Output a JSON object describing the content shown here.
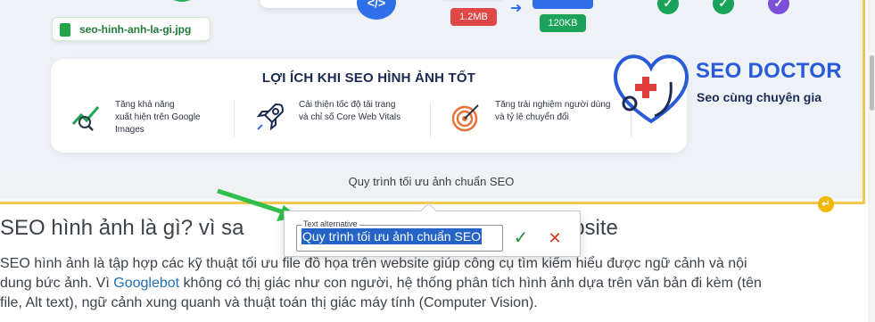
{
  "figure": {
    "file_name": "seo-hinh-anh-la-gi.jpg",
    "code_icon": "</>",
    "size_before": "1.2MB",
    "size_after": "120KB",
    "benefit_title": "LỢI ÍCH KHI SEO HÌNH ẢNH TỐT",
    "benefits": [
      {
        "text_1": "Tăng khả năng",
        "text_2": "xuất hiện trên Google",
        "text_3": "Images",
        "icon": "chart-search-icon"
      },
      {
        "text_1": "Cải thiện tốc độ tải trang",
        "text_2": "và chỉ số Core Web Vitals",
        "text_3": "",
        "icon": "rocket-icon"
      },
      {
        "text_1": "Tăng trải nghiệm người dùng",
        "text_2": "và tỷ lệ chuyển đổi",
        "text_3": "",
        "icon": "target-icon"
      }
    ],
    "logo_title": "SEO DOCTOR",
    "logo_subtitle": "Seo cùng chuyên gia",
    "caption": "Quy trình tối ưu ảnh chuẩn SEO",
    "colors": {
      "border": "#f2c94c",
      "check_green": "#1ba35a",
      "check_purple": "#7b4fd6",
      "brand_blue": "#2a5bd7"
    }
  },
  "popover": {
    "label": "Text alternative",
    "value": "Quy trình tối ưu ảnh chuẩn SEO",
    "confirm_icon": "✓",
    "cancel_icon": "✕"
  },
  "article": {
    "heading_start": "SEO hình ảnh là gì? vì sa",
    "heading_end": "g website",
    "para_1": "SEO hình ảnh là tập hợp các kỹ thuật tối ưu file đồ họa trên website giúp công cụ tìm kiếm hiểu được ngữ cảnh và nội",
    "para_2a": "dung bức ảnh. Vì ",
    "para_link": "Googlebot",
    "para_2b": " không có thị giác như con người, hệ thống phân tích hình ảnh dựa trên văn bản đi kèm (tên",
    "para_3": "file, Alt text), ngữ cảnh xung quanh và thuật toán thị giác máy tính (Computer Vision)."
  }
}
